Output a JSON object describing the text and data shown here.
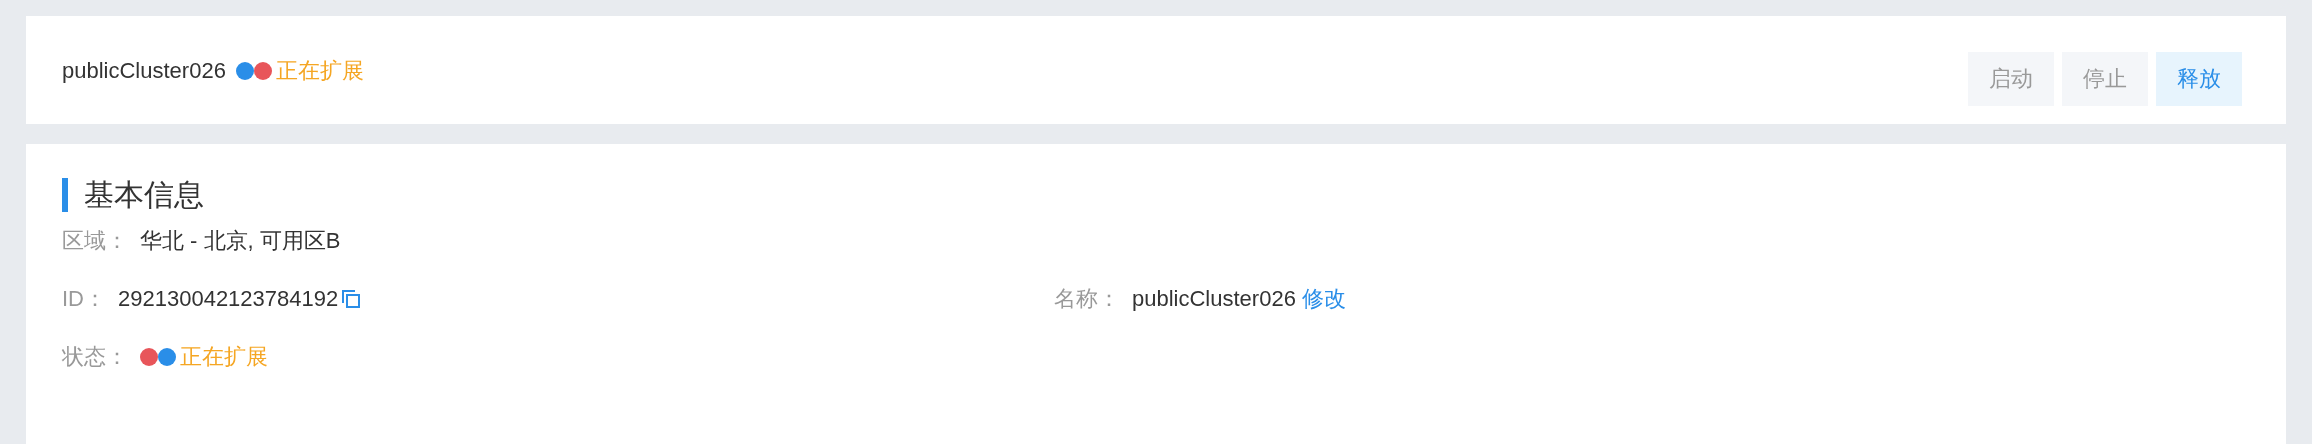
{
  "header": {
    "title": "publicCluster026",
    "status_dots": [
      {
        "color": "#2a8ee8"
      },
      {
        "color": "#e8555a"
      }
    ],
    "status": "正在扩展",
    "buttons": [
      {
        "label": "启动",
        "disabled": true
      },
      {
        "label": "停止",
        "disabled": true
      },
      {
        "label": "释放",
        "disabled": false
      }
    ]
  },
  "basic_info": {
    "heading": "基本信息",
    "fields": [
      {
        "kind": "text",
        "label": "区域：",
        "value": "华北 - 北京, 可用区B"
      },
      {
        "kind": "copy",
        "label": "ID：",
        "value": "292130042123784192"
      },
      {
        "kind": "edit",
        "label": "名称：",
        "value": "publicCluster026",
        "link": "修改"
      },
      {
        "kind": "status",
        "label": "状态：",
        "dots": [
          {
            "color": "#e8555a"
          },
          {
            "color": "#2a8ee8"
          }
        ],
        "value": "正在扩展"
      }
    ]
  }
}
